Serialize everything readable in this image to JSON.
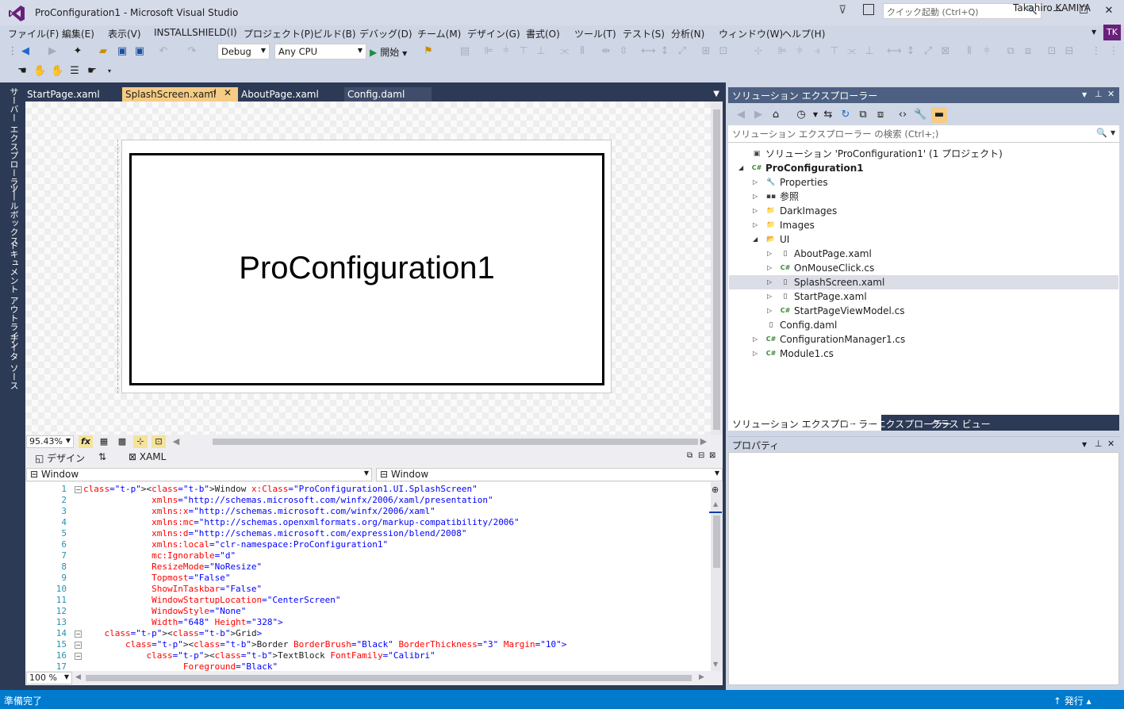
{
  "window": {
    "title": "ProConfiguration1 - Microsoft Visual Studio",
    "quick_launch_placeholder": "クイック起動 (Ctrl+Q)",
    "minimize": "—",
    "maximize": "☐",
    "close": "✕"
  },
  "menu": {
    "items": [
      "ファイル(F)",
      "編集(E)",
      "表示(V)",
      "INSTALLSHIELD(I)",
      "プロジェクト(P)",
      "ビルド(B)",
      "デバッグ(D)",
      "チーム(M)",
      "デザイン(G)",
      "書式(O)",
      "ツール(T)",
      "テスト(S)",
      "分析(N)",
      "ウィンドウ(W)",
      "ヘルプ(H)"
    ],
    "user_name": "Takahiro KAMIYA",
    "user_initials": "TK"
  },
  "toolbar": {
    "config_value": "Debug",
    "platform_value": "Any CPU",
    "start_label": "開始"
  },
  "left_tabs": [
    "サーバー エクスプローラー",
    "ツールボックス",
    "ドキュメント アウトライン",
    "データ ソース"
  ],
  "doc_tabs": [
    {
      "label": "StartPage.xaml"
    },
    {
      "label": "SplashScreen.xaml"
    },
    {
      "label": "AboutPage.xaml"
    },
    {
      "label": "Config.daml"
    }
  ],
  "designer": {
    "splash_text": "ProConfiguration1",
    "zoom": "95.43%",
    "fx_label": "fx"
  },
  "split": {
    "design_tab": "デザイン",
    "swap": "⇅",
    "xaml_tab": "XAML"
  },
  "xaml_nav": {
    "left": "Window",
    "right": "Window"
  },
  "code": {
    "zoom": "100 %",
    "lines": [
      {
        "n": "1",
        "html": "<span class='t-b'>&lt;</span><span class='t-b'>Window</span> <span class='t-attr'>x:Class</span><span class='t-p'>=</span><span class='t-val'>\"ProConfiguration1.UI.SplashScreen\"</span>",
        "text": "<Window x:Class=\"ProConfiguration1.UI.SplashScreen\""
      },
      {
        "n": "2",
        "text": "             xmlns=\"http://schemas.microsoft.com/winfx/2006/xaml/presentation\""
      },
      {
        "n": "3",
        "text": "             xmlns:x=\"http://schemas.microsoft.com/winfx/2006/xaml\""
      },
      {
        "n": "4",
        "text": "             xmlns:mc=\"http://schemas.openxmlformats.org/markup-compatibility/2006\""
      },
      {
        "n": "5",
        "text": "             xmlns:d=\"http://schemas.microsoft.com/expression/blend/2008\""
      },
      {
        "n": "6",
        "text": "             xmlns:local=\"clr-namespace:ProConfiguration1\""
      },
      {
        "n": "7",
        "text": "             mc:Ignorable=\"d\""
      },
      {
        "n": "8",
        "text": "             ResizeMode=\"NoResize\""
      },
      {
        "n": "9",
        "text": "             Topmost=\"False\""
      },
      {
        "n": "10",
        "text": "             ShowInTaskbar=\"False\""
      },
      {
        "n": "11",
        "text": "             WindowStartupLocation=\"CenterScreen\""
      },
      {
        "n": "12",
        "text": "             WindowStyle=\"None\""
      },
      {
        "n": "13",
        "text": "             Width=\"648\" Height=\"328\">"
      },
      {
        "n": "14",
        "text": "    <Grid>"
      },
      {
        "n": "15",
        "text": "        <Border BorderBrush=\"Black\" BorderThickness=\"3\" Margin=\"10\">"
      },
      {
        "n": "16",
        "text": "            <TextBlock FontFamily=\"Calibri\""
      },
      {
        "n": "17",
        "text": "                   Foreground=\"Black\""
      }
    ]
  },
  "solution_explorer": {
    "title": "ソリューション エクスプローラー",
    "search_placeholder": "ソリューション エクスプローラー の検索 (Ctrl+;)",
    "items": [
      {
        "label": "ソリューション 'ProConfiguration1' (1 プロジェクト)",
        "icon": "solution-icon",
        "glyph": "▣",
        "depth": 0,
        "arrow": "",
        "bold": false
      },
      {
        "label": "ProConfiguration1",
        "icon": "csharp-project-icon",
        "glyph": "C#",
        "depth": 0,
        "arrow": "◢",
        "bold": true
      },
      {
        "label": "Properties",
        "icon": "wrench-icon",
        "glyph": "🔧",
        "depth": 1,
        "arrow": "▷",
        "bold": false
      },
      {
        "label": "参照",
        "icon": "references-icon",
        "glyph": "▪▪",
        "depth": 1,
        "arrow": "▷",
        "bold": false
      },
      {
        "label": "DarkImages",
        "icon": "folder-icon",
        "glyph": "📁",
        "depth": 1,
        "arrow": "▷",
        "bold": false
      },
      {
        "label": "Images",
        "icon": "folder-icon",
        "glyph": "📁",
        "depth": 1,
        "arrow": "▷",
        "bold": false
      },
      {
        "label": "UI",
        "icon": "folder-open-icon",
        "glyph": "📂",
        "depth": 1,
        "arrow": "◢",
        "bold": false
      },
      {
        "label": "AboutPage.xaml",
        "icon": "xaml-file-icon",
        "glyph": "▯",
        "depth": 2,
        "arrow": "▷",
        "bold": false
      },
      {
        "label": "OnMouseClick.cs",
        "icon": "csharp-file-icon",
        "glyph": "C#",
        "depth": 2,
        "arrow": "▷",
        "bold": false
      },
      {
        "label": "SplashScreen.xaml",
        "icon": "xaml-file-icon",
        "glyph": "▯",
        "depth": 2,
        "arrow": "▷",
        "bold": false,
        "selected": true
      },
      {
        "label": "StartPage.xaml",
        "icon": "xaml-file-icon",
        "glyph": "▯",
        "depth": 2,
        "arrow": "▷",
        "bold": false
      },
      {
        "label": "StartPageViewModel.cs",
        "icon": "csharp-file-icon",
        "glyph": "C#",
        "depth": 2,
        "arrow": "▷",
        "bold": false
      },
      {
        "label": "Config.daml",
        "icon": "file-icon",
        "glyph": "▯",
        "depth": 1,
        "arrow": "",
        "bold": false
      },
      {
        "label": "ConfigurationManager1.cs",
        "icon": "csharp-file-icon",
        "glyph": "C#",
        "depth": 1,
        "arrow": "▷",
        "bold": false
      },
      {
        "label": "Module1.cs",
        "icon": "csharp-file-icon",
        "glyph": "C#",
        "depth": 1,
        "arrow": "▷",
        "bold": false
      }
    ],
    "tabs": [
      "ソリューション エクスプローラー",
      "チーム エクスプローラー",
      "クラス ビュー"
    ]
  },
  "properties": {
    "title": "プロパティ"
  },
  "status": {
    "text": "準備完了",
    "publish": "↑  発行  ▴"
  },
  "colors": {
    "accent": "#007acc",
    "panel_dark": "#2d3a55",
    "active_tab": "#f5cc84"
  }
}
